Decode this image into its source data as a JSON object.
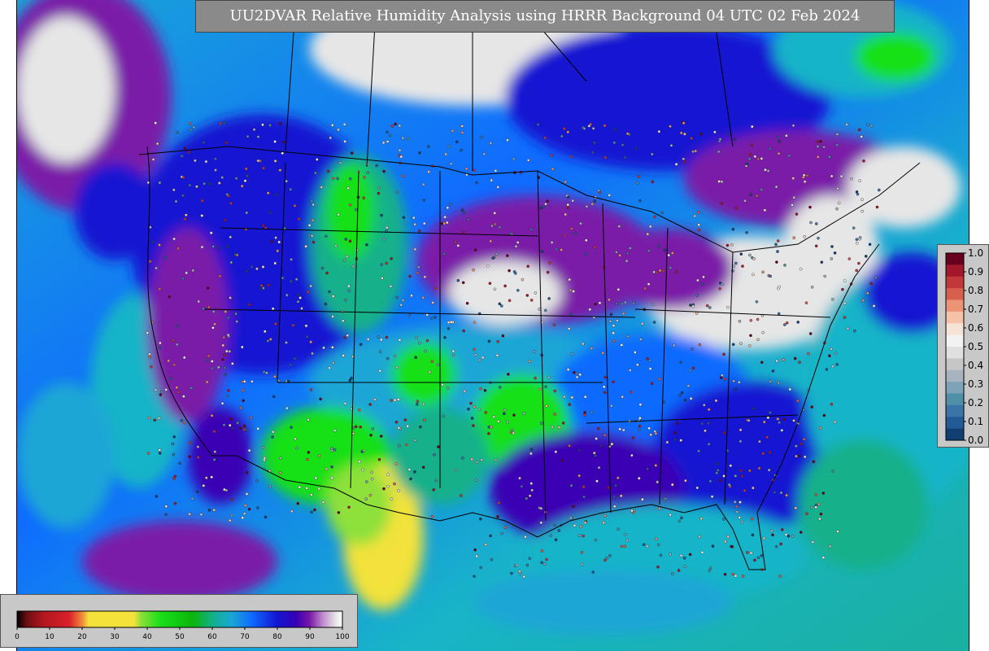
{
  "title": "UU2DVAR Relative Humidity Analysis using HRRR Background 04 UTC 02 Feb 2024",
  "humidity_colorbar": {
    "min": 0,
    "max": 100,
    "tick_labels": [
      "0",
      "10",
      "20",
      "30",
      "40",
      "50",
      "60",
      "70",
      "80",
      "90",
      "100"
    ],
    "stops": [
      {
        "value": 0,
        "color": "#000000"
      },
      {
        "value": 3,
        "color": "#6b0f12"
      },
      {
        "value": 8,
        "color": "#b3161f"
      },
      {
        "value": 16,
        "color": "#d8202a"
      },
      {
        "value": 20,
        "color": "#f08a3c"
      },
      {
        "value": 22,
        "color": "#f2e23a"
      },
      {
        "value": 36,
        "color": "#f2e23a"
      },
      {
        "value": 38,
        "color": "#8ee03a"
      },
      {
        "value": 44,
        "color": "#19e019"
      },
      {
        "value": 54,
        "color": "#0cb40c"
      },
      {
        "value": 60,
        "color": "#13b08a"
      },
      {
        "value": 66,
        "color": "#1aa6d6"
      },
      {
        "value": 72,
        "color": "#0f6bff"
      },
      {
        "value": 80,
        "color": "#1414d2"
      },
      {
        "value": 86,
        "color": "#3a00b4"
      },
      {
        "value": 90,
        "color": "#7a1aa8"
      },
      {
        "value": 94,
        "color": "#c08ccf"
      },
      {
        "value": 98,
        "color": "#e6e6e6"
      },
      {
        "value": 100,
        "color": "#ffffff"
      }
    ]
  },
  "obs_colorbar": {
    "tick_labels": [
      "1.0",
      "0.9",
      "0.8",
      "0.7",
      "0.6",
      "0.5",
      "0.4",
      "0.3",
      "0.2",
      "0.1",
      "0.0"
    ],
    "colors": [
      "#67001f",
      "#a2172a",
      "#c1373a",
      "#d6604d",
      "#eb9373",
      "#f4c3a7",
      "#f7e3d6",
      "#f2f2f2",
      "#e0e0e0",
      "#c6c6c6",
      "#a7b4bf",
      "#7ea3b8",
      "#4f8fa8",
      "#3b74a8",
      "#235a95",
      "#123f73"
    ]
  },
  "colors": {
    "panel_bg": "#c8c8c8",
    "title_bg": "#8a8a8a",
    "land_border": "#000000"
  }
}
